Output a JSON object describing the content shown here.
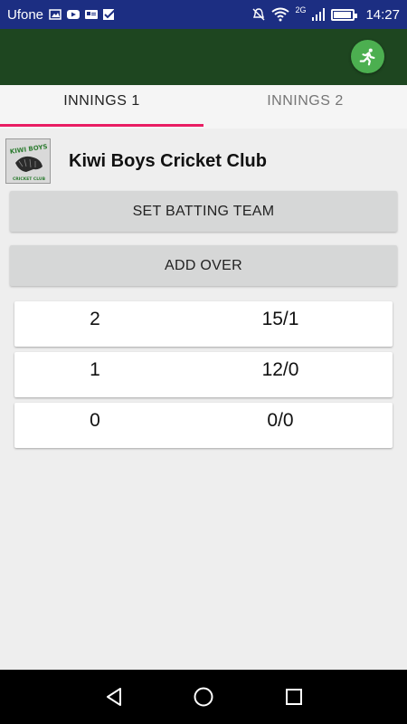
{
  "status_bar": {
    "carrier": "Ufone",
    "network": "2G",
    "time": "14:27",
    "battery_level": 0.95,
    "icons": [
      "image-icon",
      "youtube-icon",
      "card-icon",
      "check-icon",
      "mute-icon",
      "wifi-icon",
      "signal-icon",
      "battery-icon"
    ]
  },
  "app_bar": {
    "action_icon": "running-man-icon",
    "background": "#1e4620",
    "action_color": "#4caf50"
  },
  "tabs": [
    {
      "label": "INNINGS 1",
      "active": true
    },
    {
      "label": "INNINGS 2",
      "active": false
    }
  ],
  "club": {
    "name": "Kiwi Boys Cricket Club",
    "logo_text_top": "KIWI BOYS",
    "logo_text_bottom": "CRICKET CLUB"
  },
  "buttons": {
    "set_batting_team": "SET BATTING TEAM",
    "add_over": "ADD OVER"
  },
  "overs": [
    {
      "over": "2",
      "score": "15/1"
    },
    {
      "over": "1",
      "score": "12/0"
    },
    {
      "over": "0",
      "score": "0/0"
    }
  ],
  "nav": {
    "icons": [
      "back-icon",
      "home-icon",
      "recents-icon"
    ]
  }
}
